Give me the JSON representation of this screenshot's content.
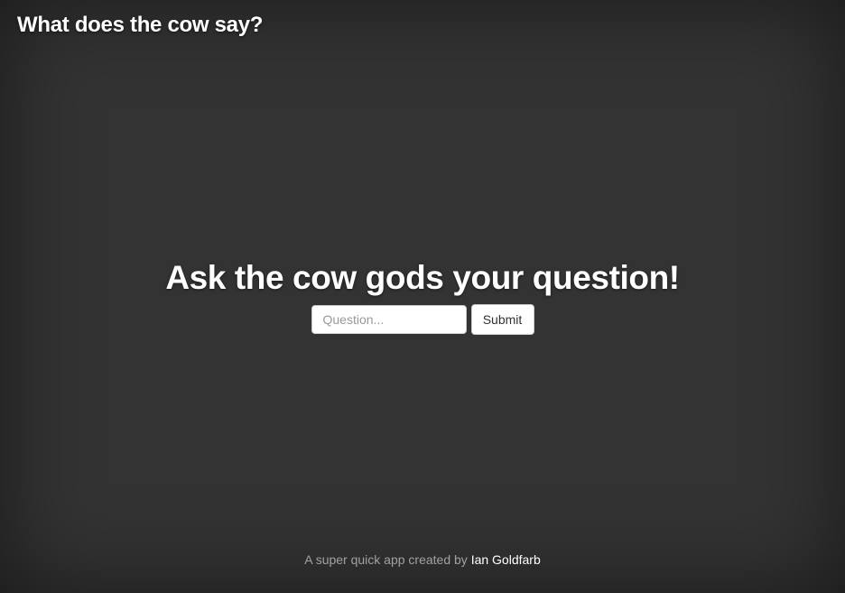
{
  "header": {
    "brand": "What does the cow say?"
  },
  "main": {
    "heading": "Ask the cow gods your question!",
    "question_input": {
      "value": "",
      "placeholder": "Question..."
    },
    "submit_label": "Submit"
  },
  "footer": {
    "text": "A super quick app created by",
    "author_link": "Ian Goldfarb"
  },
  "colors": {
    "background": "#333333",
    "text": "#ffffff"
  }
}
